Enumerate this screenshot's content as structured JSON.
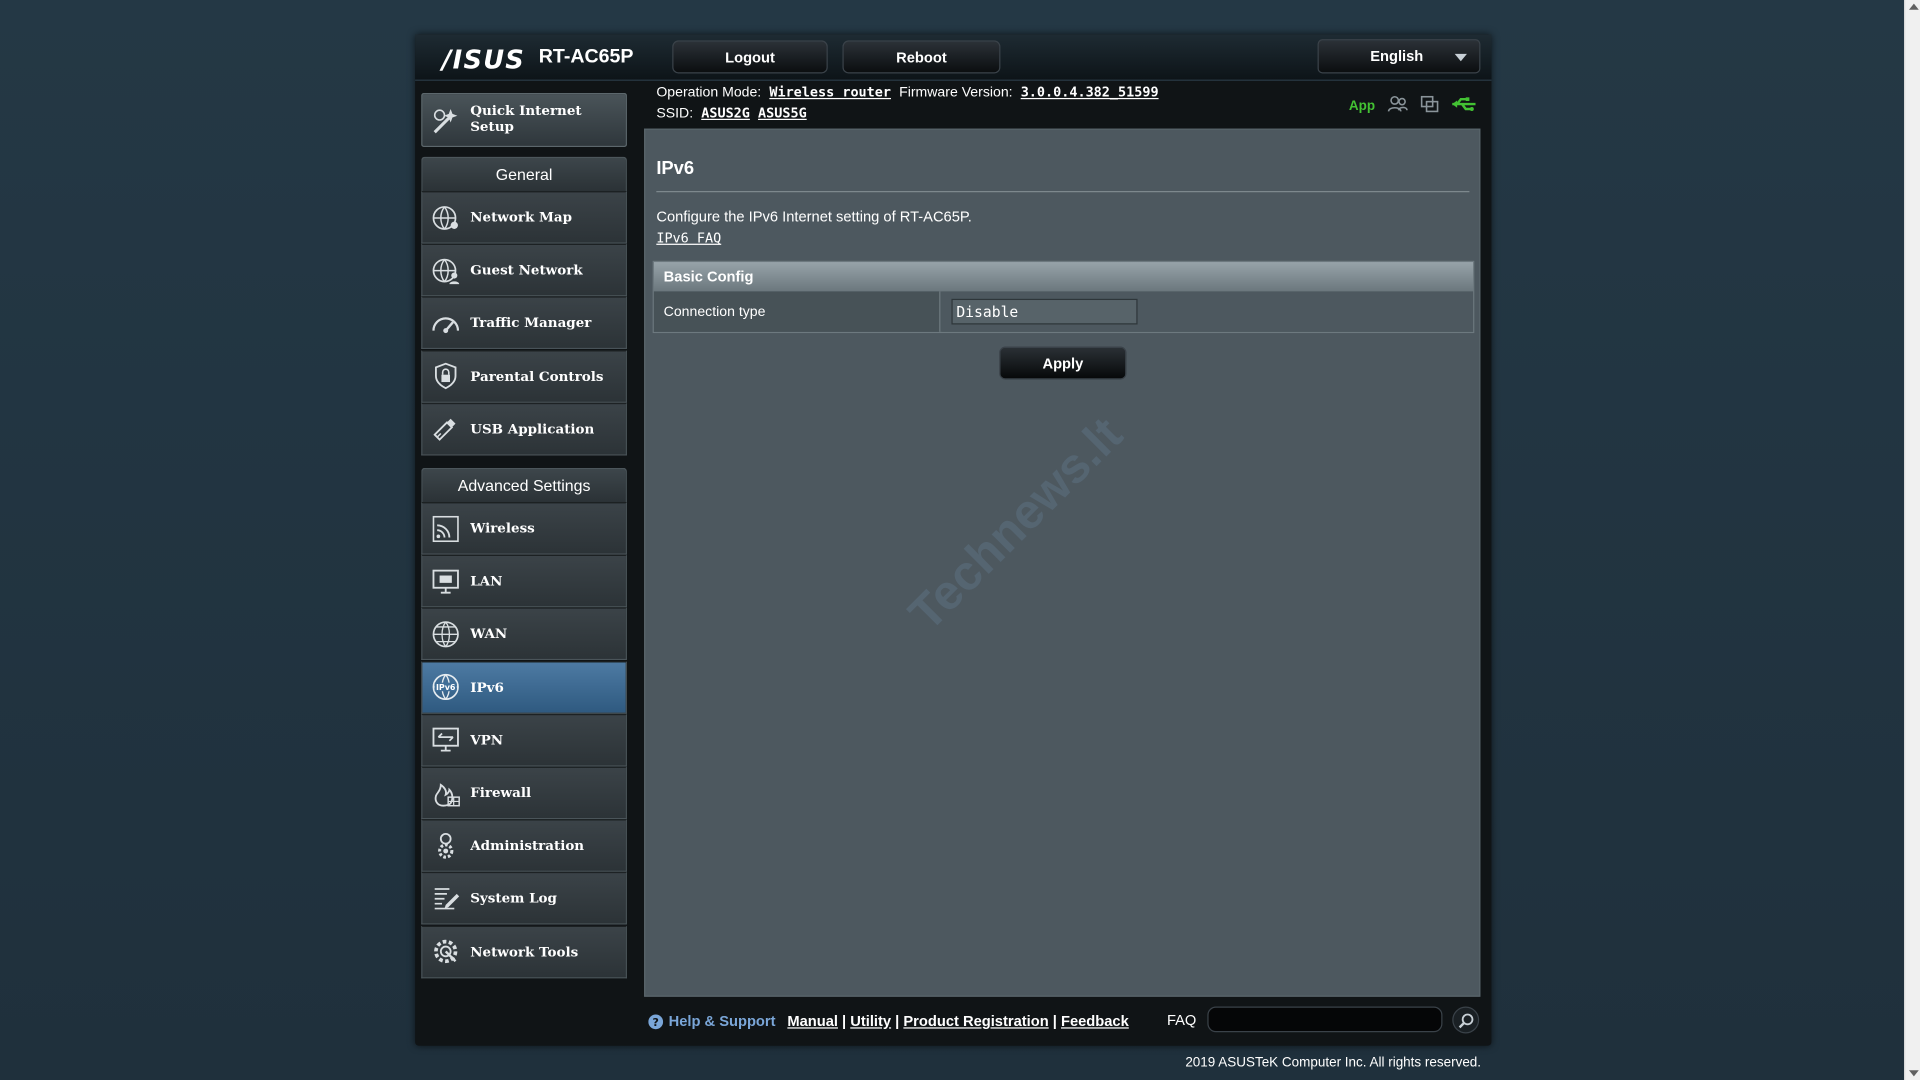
{
  "header": {
    "brand": "/ISUS",
    "model": "RT-AC65P",
    "logout_label": "Logout",
    "reboot_label": "Reboot",
    "language": "English"
  },
  "info": {
    "op_mode_label": "Operation Mode:",
    "op_mode_value": "Wireless router",
    "firmware_label": "Firmware Version:",
    "firmware_value": "3.0.0.4.382_51599",
    "ssid_label": "SSID:",
    "ssid_2g": "ASUS2G",
    "ssid_5g": "ASUS5G",
    "app_label": "App"
  },
  "sidebar": {
    "quick_setup": "Quick Internet Setup",
    "general_heading": "General",
    "general_items": [
      {
        "label": "Network Map",
        "icon": "globe-network-icon"
      },
      {
        "label": "Guest Network",
        "icon": "guest-globe-icon"
      },
      {
        "label": "Traffic Manager",
        "icon": "gauge-icon"
      },
      {
        "label": "Parental Controls",
        "icon": "shield-lock-icon"
      },
      {
        "label": "USB Application",
        "icon": "usb-stick-icon"
      }
    ],
    "advanced_heading": "Advanced Settings",
    "advanced_items": [
      {
        "label": "Wireless",
        "icon": "wifi-icon"
      },
      {
        "label": "LAN",
        "icon": "lan-monitor-icon"
      },
      {
        "label": "WAN",
        "icon": "wan-globe-icon"
      },
      {
        "label": "IPv6",
        "icon": "ipv6-globe-icon",
        "active": true
      },
      {
        "label": "VPN",
        "icon": "vpn-monitor-icon"
      },
      {
        "label": "Firewall",
        "icon": "flame-icon"
      },
      {
        "label": "Administration",
        "icon": "admin-gear-icon"
      },
      {
        "label": "System Log",
        "icon": "log-pencil-icon"
      },
      {
        "label": "Network Tools",
        "icon": "tools-gear-icon"
      }
    ]
  },
  "main": {
    "title": "IPv6",
    "description": "Configure the IPv6 Internet setting of RT-AC65P.",
    "faq_link": "IPv6 FAQ",
    "table_heading": "Basic Config",
    "connection_type_label": "Connection type",
    "connection_type_value": "Disable",
    "apply_label": "Apply",
    "watermark": "Technews.lt"
  },
  "footer": {
    "help_label": "Help & Support",
    "manual": "Manual",
    "utility": "Utility",
    "product_registration": "Product Registration",
    "feedback": "Feedback",
    "faq_label": "FAQ",
    "copyright": "2019 ASUSTeK Computer Inc. All rights reserved."
  },
  "colors": {
    "active_item": "#3f6e98",
    "app_green": "#43c233",
    "help_blue": "#7aa6d8"
  }
}
